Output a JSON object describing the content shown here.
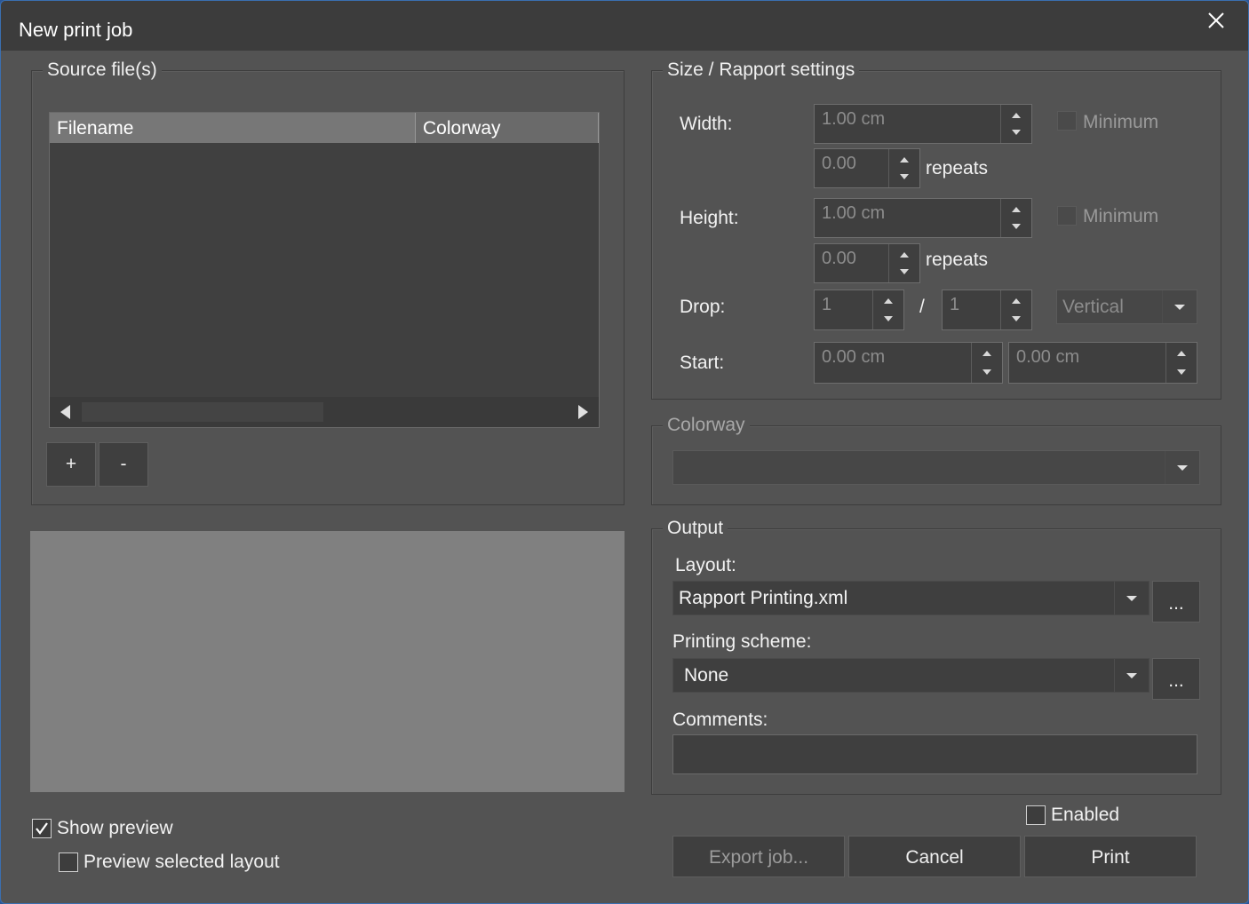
{
  "window": {
    "title": "New print job"
  },
  "source": {
    "group_title": "Source file(s)",
    "columns": [
      "Filename",
      "Colorway"
    ],
    "add_label": "+",
    "remove_label": "-"
  },
  "size": {
    "group_title": "Size / Rapport settings",
    "width_label": "Width:",
    "width_value": "1.00 cm",
    "width_repeats": "0.00",
    "repeats_label": "repeats",
    "minimum_label": "Minimum",
    "height_label": "Height:",
    "height_value": "1.00 cm",
    "height_repeats": "0.00",
    "drop_label": "Drop:",
    "drop_num": "1",
    "drop_sep": "/",
    "drop_den": "1",
    "drop_direction": "Vertical",
    "start_label": "Start:",
    "start_x": "0.00 cm",
    "start_y": "0.00 cm"
  },
  "colorway": {
    "group_title": "Colorway",
    "value": ""
  },
  "output": {
    "group_title": "Output",
    "layout_label": "Layout:",
    "layout_value": "Rapport Printing.xml",
    "browse_label": "...",
    "scheme_label": "Printing scheme:",
    "scheme_value": "None",
    "comments_label": "Comments:",
    "comments_value": ""
  },
  "options": {
    "show_preview": "Show preview",
    "show_preview_checked": true,
    "preview_selected_layout": "Preview selected layout",
    "preview_selected_layout_checked": false,
    "enabled": "Enabled",
    "enabled_checked": false
  },
  "actions": {
    "export": "Export job...",
    "cancel": "Cancel",
    "print": "Print"
  }
}
